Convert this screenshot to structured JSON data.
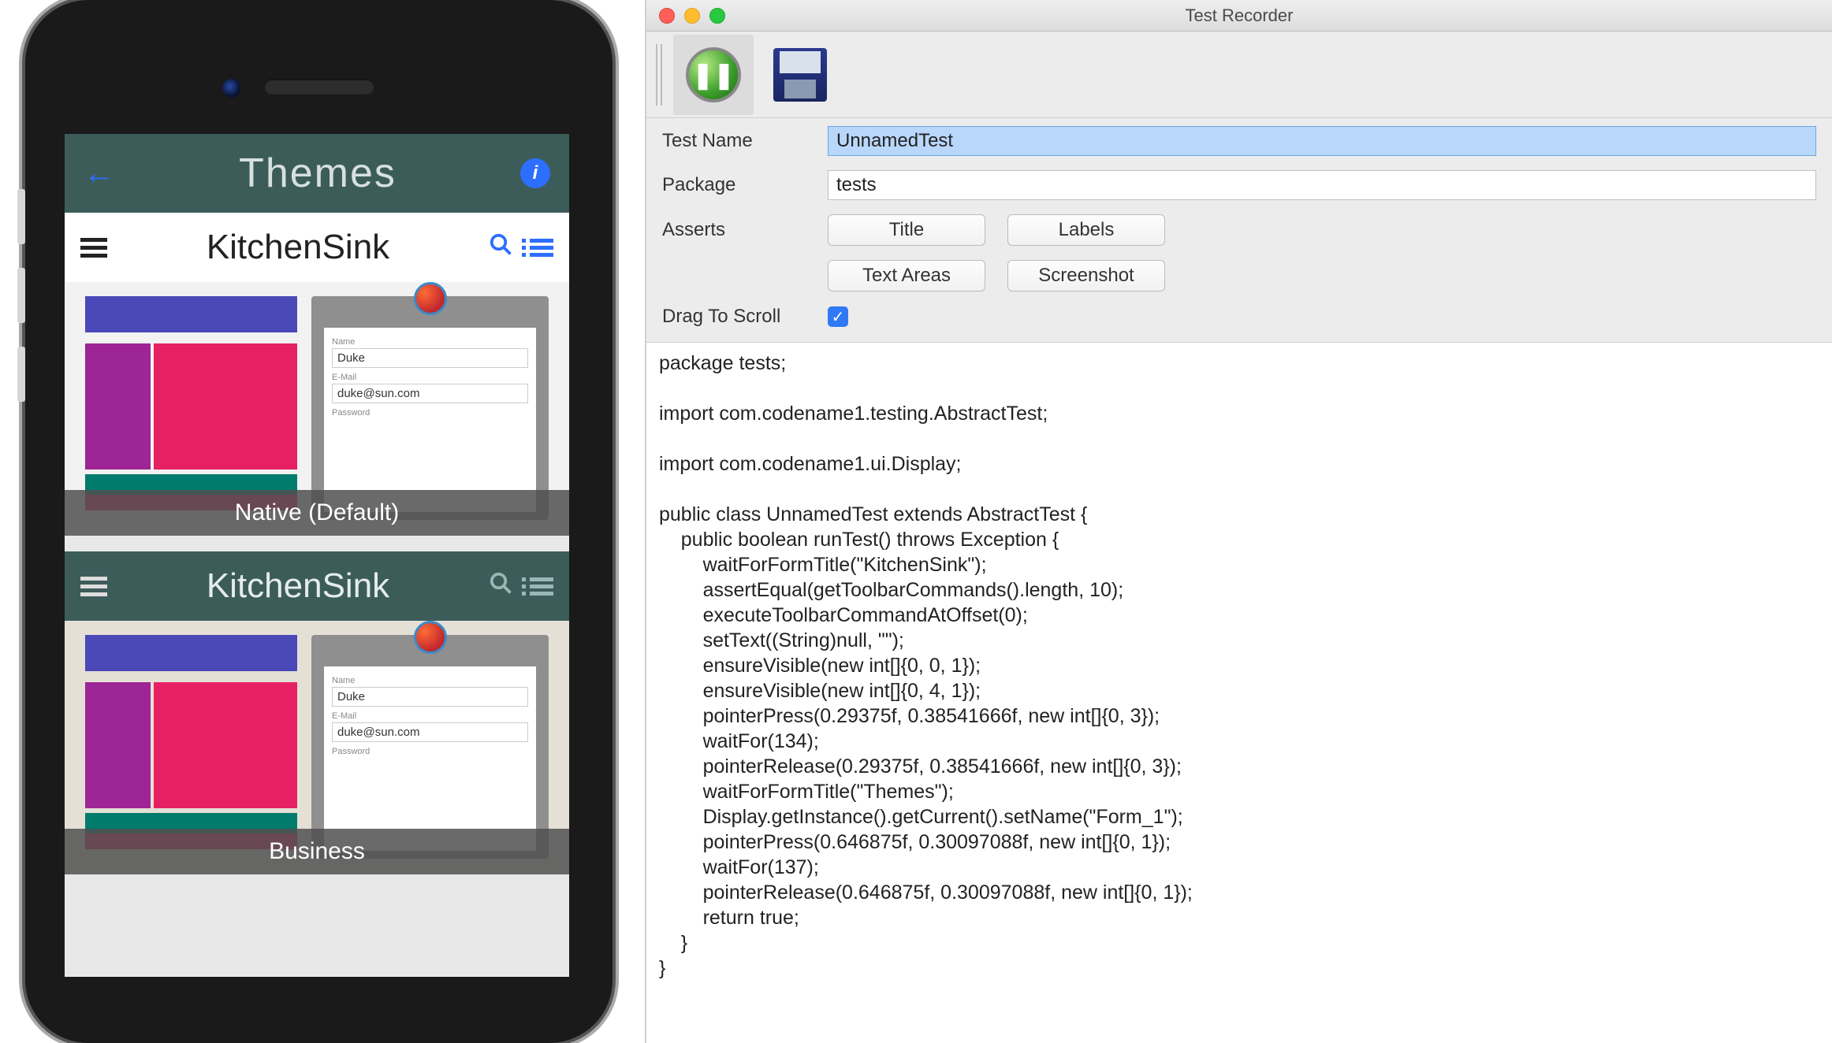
{
  "window": {
    "title": "Test Recorder"
  },
  "toolbar": {
    "record_tooltip": "Record",
    "save_tooltip": "Save"
  },
  "form": {
    "test_name_label": "Test Name",
    "test_name_value": "UnnamedTest",
    "package_label": "Package",
    "package_value": "tests",
    "asserts_label": "Asserts",
    "btn_title": "Title",
    "btn_labels": "Labels",
    "btn_textareas": "Text Areas",
    "btn_screenshot": "Screenshot",
    "drag_to_scroll_label": "Drag To Scroll",
    "drag_to_scroll_checked": true
  },
  "code": "package tests;\n\nimport com.codename1.testing.AbstractTest;\n\nimport com.codename1.ui.Display;\n\npublic class UnnamedTest extends AbstractTest {\n    public boolean runTest() throws Exception {\n        waitForFormTitle(\"KitchenSink\");\n        assertEqual(getToolbarCommands().length, 10);\n        executeToolbarCommandAtOffset(0);\n        setText((String)null, \"\");\n        ensureVisible(new int[]{0, 0, 1});\n        ensureVisible(new int[]{0, 4, 1});\n        pointerPress(0.29375f, 0.38541666f, new int[]{0, 3});\n        waitFor(134);\n        pointerRelease(0.29375f, 0.38541666f, new int[]{0, 3});\n        waitForFormTitle(\"Themes\");\n        Display.getInstance().getCurrent().setName(\"Form_1\");\n        pointerPress(0.646875f, 0.30097088f, new int[]{0, 1});\n        waitFor(137);\n        pointerRelease(0.646875f, 0.30097088f, new int[]{0, 1});\n        return true;\n    }\n}",
  "simulator": {
    "header_title": "Themes",
    "preview_app_title": "KitchenSink",
    "card1_caption": "Native (Default)",
    "card2_caption": "Business",
    "mock_form": {
      "name_label": "Name",
      "name_value": "Duke",
      "email_label": "E-Mail",
      "email_value": "duke@sun.com",
      "password_label": "Password"
    }
  }
}
